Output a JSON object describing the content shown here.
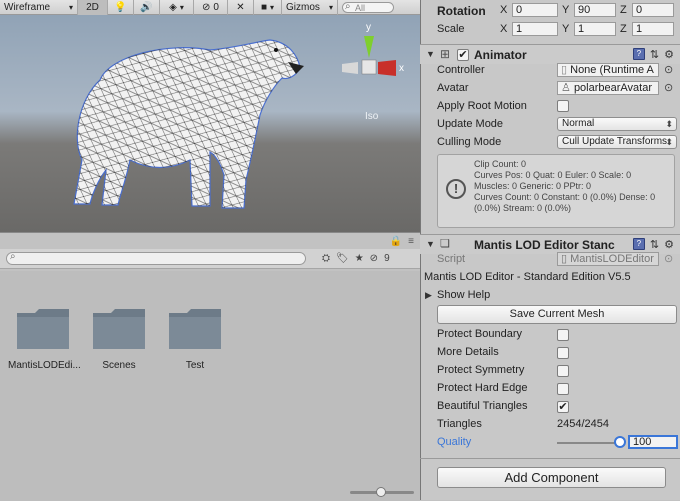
{
  "scene": {
    "toolbar": {
      "shading_mode": "Wireframe",
      "mode_2d": "2D",
      "hidden_count": "0",
      "gizmos_label": "Gizmos",
      "search_placeholder": "All"
    },
    "projection_label": "Iso"
  },
  "project": {
    "layer_count": "9",
    "folders": [
      {
        "label": "MantisLODEdi..."
      },
      {
        "label": "Scenes"
      },
      {
        "label": "Test"
      }
    ]
  },
  "inspector": {
    "transform": {
      "rotation_label": "Rotation",
      "rotation": {
        "x": "0",
        "y": "90",
        "z": "0"
      },
      "scale_label": "Scale",
      "scale": {
        "x": "1",
        "y": "1",
        "z": "1"
      }
    },
    "animator": {
      "title": "Animator",
      "enabled": true,
      "controller_label": "Controller",
      "controller_value": "None (Runtime A",
      "avatar_label": "Avatar",
      "avatar_value": "polarbearAvatar",
      "apply_root_motion_label": "Apply Root Motion",
      "update_mode_label": "Update Mode",
      "update_mode_value": "Normal",
      "culling_mode_label": "Culling Mode",
      "culling_mode_value": "Cull Update Transforms",
      "info_text": "Clip Count: 0\nCurves Pos: 0 Quat: 0 Euler: 0 Scale: 0\nMuscles: 0 Generic: 0 PPtr: 0\nCurves Count: 0 Constant: 0 (0.0%) Dense: 0\n(0.0%) Stream: 0 (0.0%)"
    },
    "mantis": {
      "title": "Mantis LOD Editor Stanc",
      "script_label": "Script",
      "script_value": "MantisLODEditor",
      "heading": "Mantis LOD Editor - Standard Edition V5.5",
      "show_help_label": "Show Help",
      "save_button": "Save Current Mesh",
      "protect_boundary_label": "Protect Boundary",
      "protect_boundary": false,
      "more_details_label": "More Details",
      "more_details": false,
      "protect_symmetry_label": "Protect Symmetry",
      "protect_symmetry": false,
      "protect_hard_edge_label": "Protect Hard Edge",
      "protect_hard_edge": false,
      "beautiful_triangles_label": "Beautiful Triangles",
      "beautiful_triangles": true,
      "triangles_label": "Triangles",
      "triangles_value": "2454/2454",
      "quality_label": "Quality",
      "quality_value": "100"
    },
    "add_component_button": "Add Component",
    "accent_color": "#3a76d8"
  }
}
